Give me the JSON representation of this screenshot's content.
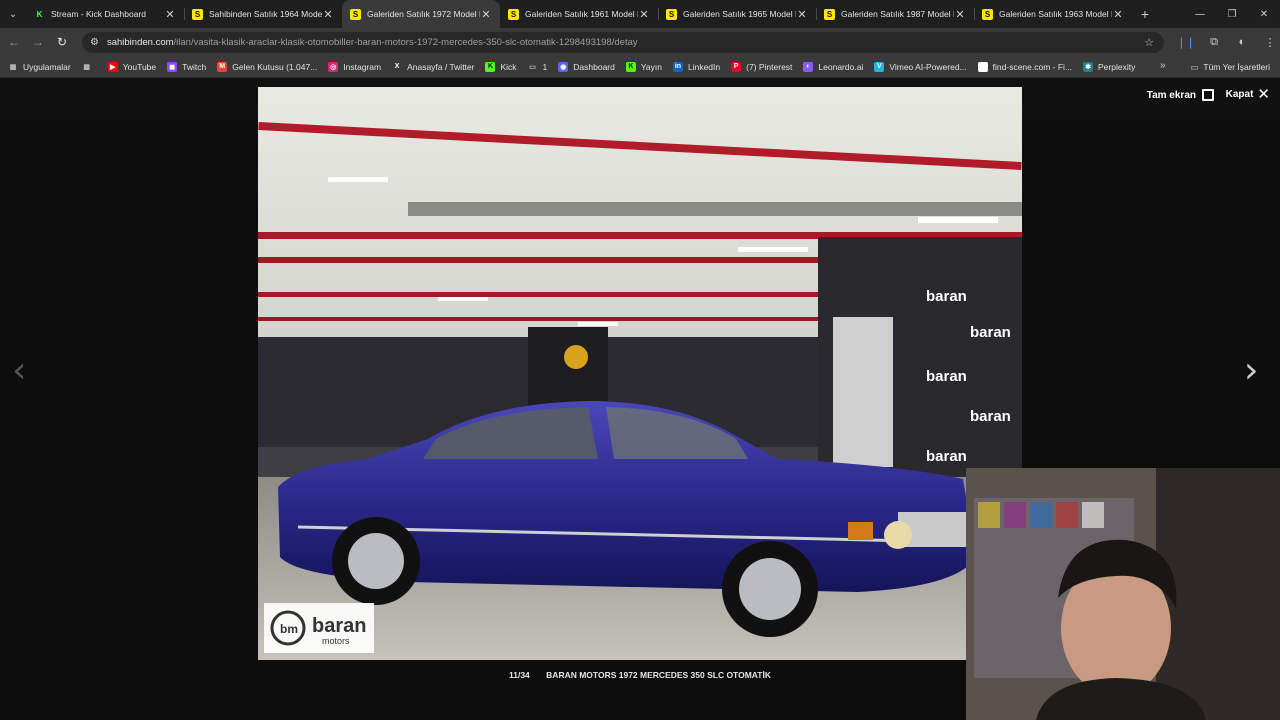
{
  "tabs": [
    {
      "title": "Stream - Kick Dashboard",
      "icon": "kick-favicon-icon",
      "active": false
    },
    {
      "title": "Sahibinden Satılık 1964 Model K",
      "icon": "sahibinden-favicon-icon",
      "active": false
    },
    {
      "title": "Galeriden Satılık 1972 Model K",
      "icon": "sahibinden-favicon-icon",
      "active": true
    },
    {
      "title": "Galeriden Satılık 1961 Model K",
      "icon": "sahibinden-favicon-icon",
      "active": false
    },
    {
      "title": "Galeriden Satılık 1965 Model K",
      "icon": "sahibinden-favicon-icon",
      "active": false
    },
    {
      "title": "Galeriden Satılık 1987 Model K",
      "icon": "sahibinden-favicon-icon",
      "active": false
    },
    {
      "title": "Galeriden Satılık 1963 Model K",
      "icon": "sahibinden-favicon-icon",
      "active": false
    }
  ],
  "address": {
    "domain": "sahibinden.com",
    "path": "/ilan/vasita-klasik-araclar-klasik-otomobiller-baran-motors-1972-mercedes-350-slc-otomatik-1298493198/detay"
  },
  "bookmarks": [
    {
      "label": "Uygulamalar",
      "icon": "apps-icon",
      "color": "#c0c0c0"
    },
    {
      "label": "",
      "icon": "grid-icon",
      "color": "#c0c0c0"
    },
    {
      "label": "YouTube",
      "icon": "youtube-icon",
      "color": "#ff0000"
    },
    {
      "label": "Twitch",
      "icon": "twitch-icon",
      "color": "#9146ff"
    },
    {
      "label": "Gelen Kutusu (1.047...",
      "icon": "gmail-icon",
      "color": "#ea4335"
    },
    {
      "label": "Instagram",
      "icon": "instagram-icon",
      "color": "#d62976"
    },
    {
      "label": "Anasayfa / Twitter",
      "icon": "x-icon",
      "color": "#000000"
    },
    {
      "label": "Kick",
      "icon": "kick-icon",
      "color": "#53fc18"
    },
    {
      "label": "1",
      "icon": "folder-icon",
      "color": "#c0c0c0"
    },
    {
      "label": "Dashboard",
      "icon": "dashboard-icon",
      "color": "#5865f2"
    },
    {
      "label": "Yayın",
      "icon": "kick-icon",
      "color": "#53fc18"
    },
    {
      "label": "LinkedIn",
      "icon": "linkedin-icon",
      "color": "#0a66c2"
    },
    {
      "label": "(7) Pinterest",
      "icon": "pinterest-icon",
      "color": "#e60023"
    },
    {
      "label": "Leonardo.ai",
      "icon": "leonardo-icon",
      "color": "#8a5cf6"
    },
    {
      "label": "Vimeo AI-Powered...",
      "icon": "vimeo-icon",
      "color": "#1ab7ea"
    },
    {
      "label": "find-scene.com - Fi...",
      "icon": "find-scene-icon",
      "color": "#ffffff"
    },
    {
      "label": "Perplexity",
      "icon": "perplexity-icon",
      "color": "#20808d"
    }
  ],
  "bookmarks_right": "Tüm Yer İşaretleri",
  "gallery": {
    "fullscreen_label": "Tam ekran",
    "close_label": "Kapat",
    "counter": "11/34",
    "caption": "BARAN MOTORS 1972 MERCEDES 350 SLC OTOMATİK",
    "photo_logo_main": "baran",
    "photo_logo_sub": "motors",
    "photo_logo_mark": "bm"
  }
}
